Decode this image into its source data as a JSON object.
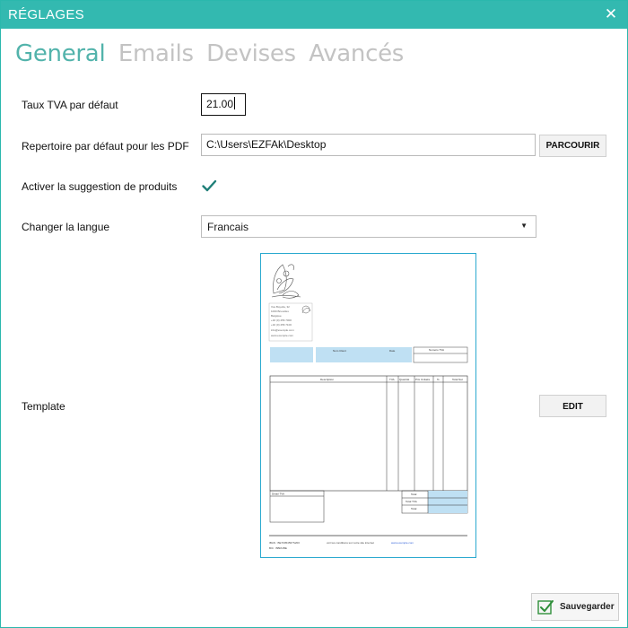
{
  "window": {
    "title": "RÉGLAGES",
    "close_glyph": "✕"
  },
  "tabs": [
    {
      "label": "General",
      "active": true
    },
    {
      "label": "Emails",
      "active": false
    },
    {
      "label": "Devises",
      "active": false
    },
    {
      "label": "Avancés",
      "active": false
    }
  ],
  "settings": {
    "vat": {
      "label": "Taux TVA par défaut",
      "value": "21.00"
    },
    "pdf_dir": {
      "label": "Repertoire par défaut pour les PDF",
      "value": "C:\\Users\\EZFAk\\Desktop",
      "browse_label": "PARCOURIR"
    },
    "suggestions": {
      "label": "Activer la suggestion de produits",
      "checked": true
    },
    "language": {
      "label": "Changer la langue",
      "value": "Francais"
    },
    "template": {
      "label": "Template",
      "edit_label": "EDIT"
    }
  },
  "template_preview": {
    "address_lines": [
      "Vos Boyvda, 32",
      "1000 Bruxelles",
      "Belgique",
      "+32 (0) 456 7000",
      "+32 (0) 456 7100",
      "info@exemple.com",
      "www.exemple.com"
    ],
    "client_headers": [
      "Num Client",
      "Date",
      "Numéro TVA"
    ],
    "table_headers": [
      "Description",
      "TVA",
      "Quantité",
      "Prix Unitaire",
      "%",
      "Total Net"
    ],
    "vat_box_label": "Détail TVA",
    "totals": [
      "Total",
      "Total TVA",
      "Total"
    ],
    "footer_left": [
      "IBAN : BE70054567S200",
      "BIC : BBRUBE"
    ],
    "footer_right_text": "voir les conditions sur notre site internet",
    "footer_link": "www.exemple.com"
  },
  "footer": {
    "save_label": "Sauvegarder"
  },
  "colors": {
    "accent": "#33b9b0",
    "tab_active": "#52b3ab",
    "tab_inactive": "#c3c3c3",
    "check": "#1f7f78",
    "preview_fill": "#bfe0f3"
  },
  "icons": {
    "close": "close-icon",
    "check": "checkmark-icon",
    "dropdown": "chevron-down-icon",
    "save": "save-check-icon",
    "logo": "floral-logo-icon"
  }
}
